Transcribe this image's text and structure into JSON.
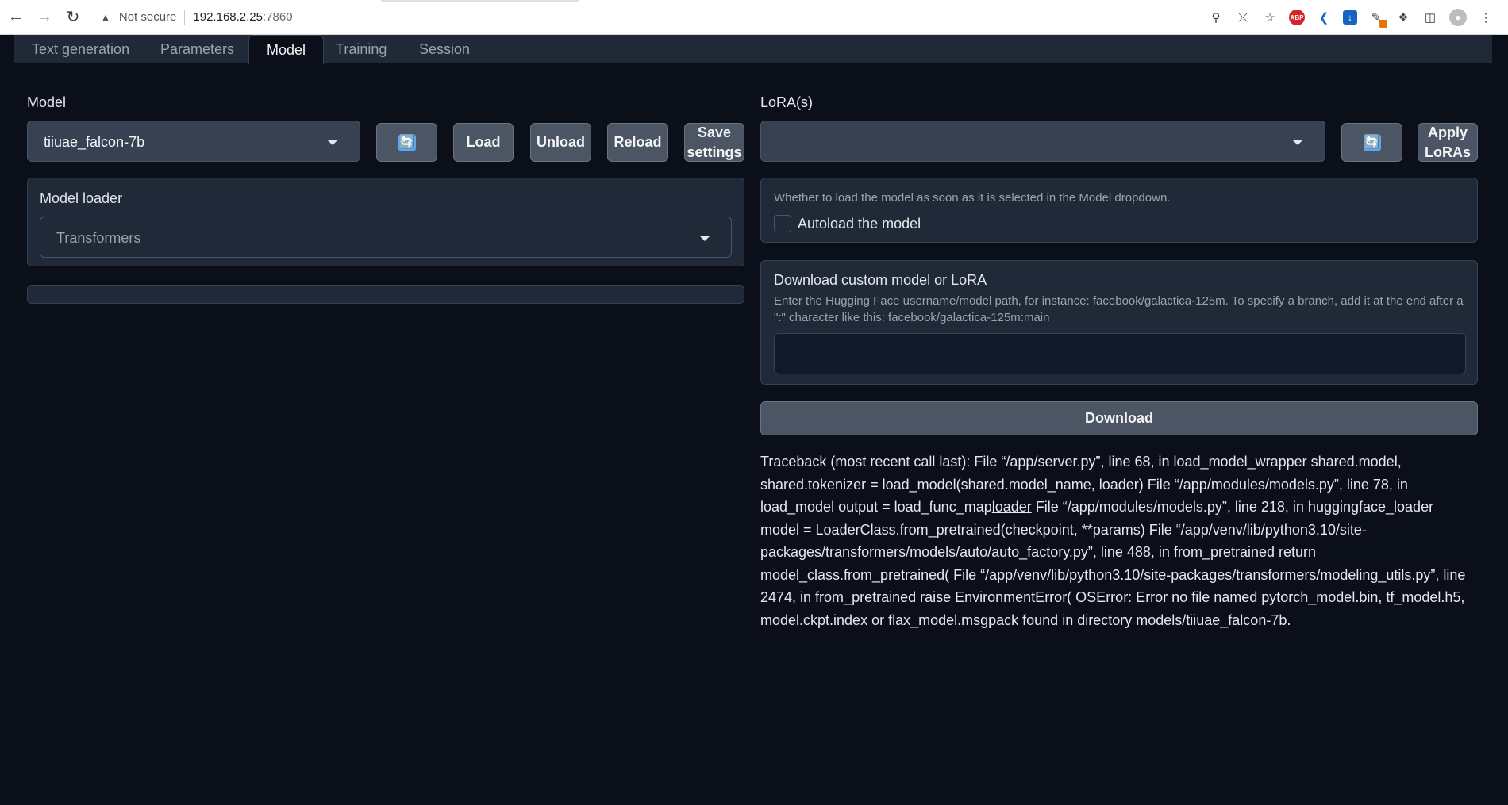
{
  "browser": {
    "security_label": "Not secure",
    "url_host": "192.168.2.25",
    "url_port": ":7860",
    "ext_abp": "ABP"
  },
  "tabs": [
    {
      "label": "Text generation"
    },
    {
      "label": "Parameters"
    },
    {
      "label": "Model"
    },
    {
      "label": "Training"
    },
    {
      "label": "Session"
    }
  ],
  "model": {
    "label": "Model",
    "selected": "tiiuae_falcon-7b",
    "refresh_label": "🔄",
    "load_label": "Load",
    "unload_label": "Unload",
    "reload_label": "Reload",
    "save_label_line1": "Save",
    "save_label_line2": "settings"
  },
  "loader": {
    "label": "Model loader",
    "selected": "Transformers"
  },
  "lora": {
    "label": "LoRA(s)",
    "selected": "",
    "refresh_label": "🔄",
    "apply_line1": "Apply",
    "apply_line2": "LoRAs"
  },
  "autoload": {
    "info": "Whether to load the model as soon as it is selected in the Model dropdown.",
    "label": "Autoload the model",
    "checked": false
  },
  "download": {
    "title": "Download custom model or LoRA",
    "info": "Enter the Hugging Face username/model path, for instance: facebook/galactica-125m. To specify a branch, add it at the end after a \":\" character like this: facebook/galactica-125m:main",
    "value": "",
    "button_label": "Download"
  },
  "traceback": {
    "part1": "Traceback (most recent call last): File “/app/server.py”, line 68, in load_model_wrapper shared.model, shared.tokenizer = load_model(shared.model_name, loader) File “/app/modules/models.py”, line 78, in load_model output = load_func_map",
    "underlined": "loader",
    "part2": " File “/app/modules/models.py”, line 218, in huggingface_loader model = LoaderClass.from_pretrained(checkpoint, **params) File “/app/venv/lib/python3.10/site-packages/transformers/models/auto/auto_factory.py”, line 488, in from_pretrained return model_class.from_pretrained( File “/app/venv/lib/python3.10/site-packages/transformers/modeling_utils.py”, line 2474, in from_pretrained raise EnvironmentError( OSError: Error no file named pytorch_model.bin, tf_model.h5, model.ckpt.index or flax_model.msgpack found in directory models/tiiuae_falcon-7b."
  }
}
